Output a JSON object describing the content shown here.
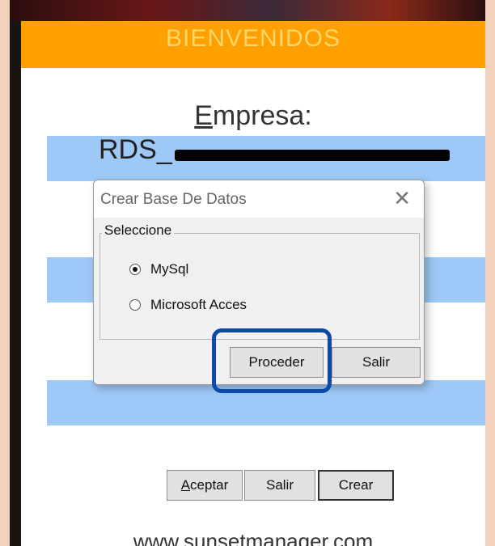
{
  "window": {
    "banner": "BIENVENIDOS",
    "empresa_label_first": "E",
    "empresa_label_rest": "mpresa:",
    "company_name": "RDS_",
    "website": "www.sunsetmanager.com"
  },
  "dialog": {
    "title": "Crear Base De Datos",
    "close_glyph": "✕",
    "group_label": "Seleccione",
    "options": [
      {
        "label": "MySql",
        "selected": true
      },
      {
        "label": "Microsoft Acces",
        "selected": false
      }
    ],
    "proceed_label": "Proceder",
    "exit_label": "Salir"
  },
  "buttons": {
    "aceptar_first": "A",
    "aceptar_rest": "ceptar",
    "salir": "Salir",
    "crear": "Crear"
  },
  "colors": {
    "banner": "#ffa000",
    "band": "#9ec8f5",
    "highlight": "#0b4aa8",
    "page_bg": "#f3d2bd"
  }
}
